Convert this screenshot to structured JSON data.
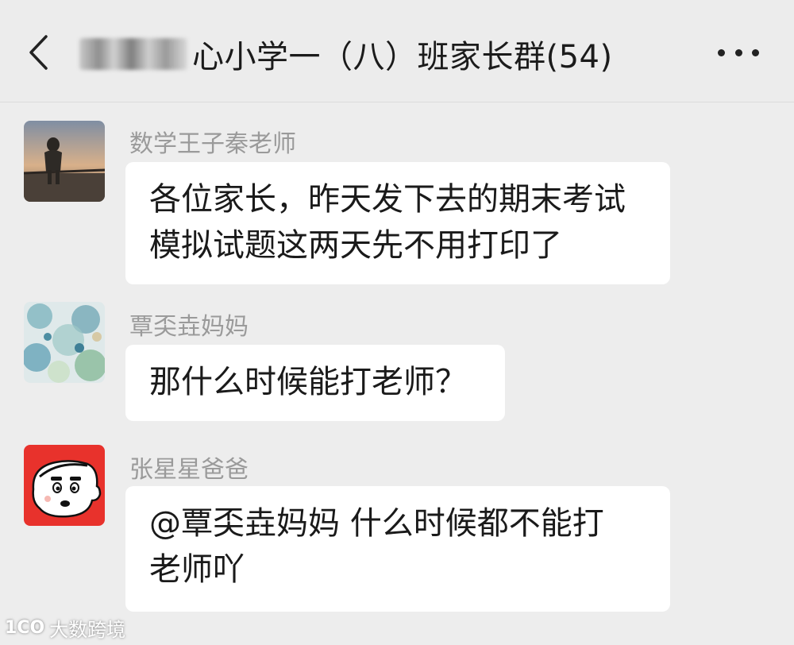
{
  "header": {
    "title": "心小学一（八）班家长群(54)",
    "back_icon": "chevron-left-icon",
    "more_icon": "more-dots-icon"
  },
  "messages": [
    {
      "sender": "数学王子秦老师",
      "lines": [
        "各位家长，昨天发下去的期末考试",
        "模拟试题这两天先不用打印了"
      ],
      "avatar_icon": "person-sunset-avatar"
    },
    {
      "sender": "覃奀垚妈妈",
      "lines": [
        "那什么时候能打老师？"
      ],
      "avatar_icon": "floral-painting-avatar"
    },
    {
      "sender": "张星星爸爸",
      "lines": [
        "@覃奀垚妈妈 什么时候都不能打",
        "老师吖"
      ],
      "avatar_icon": "cartoon-boy-avatar"
    }
  ],
  "watermark": {
    "logo": "1CO",
    "text": "大数跨境"
  },
  "colors": {
    "background": "#ededed",
    "bubble": "#ffffff",
    "sender_name": "#9a9a9a",
    "avatar3_red": "#e8322c"
  }
}
